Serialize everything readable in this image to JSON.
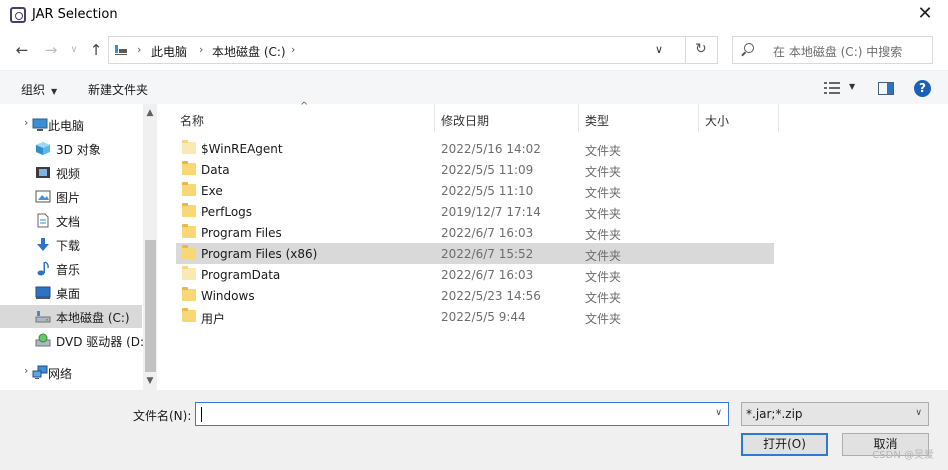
{
  "window": {
    "title": "JAR Selection",
    "close_label": "✕"
  },
  "nav": {
    "back_icon": "←",
    "forward_icon": "→",
    "recent_icon": "∨",
    "up_icon": "↑"
  },
  "address": {
    "segments": [
      "此电脑",
      "本地磁盘 (C:)"
    ],
    "separator": "›",
    "dropdown_icon": "∨",
    "refresh_icon": "↻"
  },
  "search": {
    "placeholder": "在 本地磁盘 (C:) 中搜索"
  },
  "toolbar": {
    "organize_label": "组织",
    "organize_caret": "▼",
    "new_folder_label": "新建文件夹",
    "view_caret": "▼",
    "help_label": "?"
  },
  "sidebar": {
    "items": [
      {
        "label": "此电脑",
        "icon": "pc-icon",
        "selected": false
      },
      {
        "label": "3D 对象",
        "icon": "3d-objects-icon",
        "selected": false
      },
      {
        "label": "视频",
        "icon": "video-icon",
        "selected": false
      },
      {
        "label": "图片",
        "icon": "pictures-icon",
        "selected": false
      },
      {
        "label": "文档",
        "icon": "documents-icon",
        "selected": false
      },
      {
        "label": "下载",
        "icon": "download-icon",
        "selected": false
      },
      {
        "label": "音乐",
        "icon": "music-icon",
        "selected": false
      },
      {
        "label": "桌面",
        "icon": "desktop-icon",
        "selected": false
      },
      {
        "label": "本地磁盘 (C:)",
        "icon": "drive-icon",
        "selected": true
      },
      {
        "label": "DVD 驱动器 (D:",
        "icon": "dvd-drive-icon",
        "selected": false
      },
      {
        "label": "网络",
        "icon": "network-icon",
        "selected": false
      }
    ],
    "expand_chevron": "›"
  },
  "columns": {
    "name": "名称",
    "date": "修改日期",
    "type": "类型",
    "size": "大小",
    "sort_indicator": "^"
  },
  "files": [
    {
      "name": "$WinREAgent",
      "date": "2022/5/16 14:02",
      "type": "文件夹",
      "selected": false,
      "pale": true
    },
    {
      "name": "Data",
      "date": "2022/5/5 11:09",
      "type": "文件夹",
      "selected": false,
      "pale": false
    },
    {
      "name": "Exe",
      "date": "2022/5/5 11:10",
      "type": "文件夹",
      "selected": false,
      "pale": false
    },
    {
      "name": "PerfLogs",
      "date": "2019/12/7 17:14",
      "type": "文件夹",
      "selected": false,
      "pale": false
    },
    {
      "name": "Program Files",
      "date": "2022/6/7 16:03",
      "type": "文件夹",
      "selected": false,
      "pale": false
    },
    {
      "name": "Program Files (x86)",
      "date": "2022/6/7 15:52",
      "type": "文件夹",
      "selected": true,
      "pale": false
    },
    {
      "name": "ProgramData",
      "date": "2022/6/7 16:03",
      "type": "文件夹",
      "selected": false,
      "pale": true
    },
    {
      "name": "Windows",
      "date": "2022/5/23 14:56",
      "type": "文件夹",
      "selected": false,
      "pale": false
    },
    {
      "name": "用户",
      "date": "2022/5/5 9:44",
      "type": "文件夹",
      "selected": false,
      "pale": false
    }
  ],
  "footer": {
    "filename_label": "文件名(N):",
    "filename_value": "",
    "filter_value": "*.jar;*.zip",
    "dropdown_icon": "∨",
    "open_label": "打开(O)",
    "cancel_label": "取消",
    "watermark": "CSDN @吴爱"
  },
  "colors": {
    "selection": "#d9d9d9",
    "accent": "#2e7ad1",
    "folder": "#f8d775"
  }
}
